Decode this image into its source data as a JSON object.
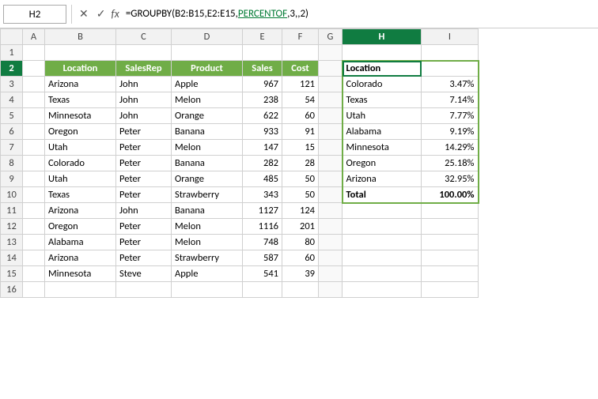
{
  "topbar": {
    "cell_ref": "H2",
    "fx_symbol": "fx",
    "formula": "=GROUPBY(B2:B15,E2:E15,PERCENTOF,3,,2)",
    "formula_parts": {
      "before": "=GROUPBY(B2:B15,E2:E15,",
      "highlighted": "PERCENTOF",
      "after": ",3,,2)"
    }
  },
  "col_headers": [
    "",
    "A",
    "B",
    "C",
    "D",
    "E",
    "F",
    "G",
    "H",
    "I"
  ],
  "rows": [
    {
      "row": "1",
      "cells": [
        "",
        "",
        "",
        "",
        "",
        "",
        "",
        "",
        "",
        ""
      ]
    },
    {
      "row": "2",
      "cells": [
        "",
        "",
        "Location",
        "SalesRep",
        "Product",
        "Sales",
        "Cost",
        "",
        "Location",
        ""
      ]
    },
    {
      "row": "3",
      "cells": [
        "",
        "",
        "Arizona",
        "John",
        "Apple",
        "967",
        "121",
        "",
        "Colorado",
        "3.47%"
      ]
    },
    {
      "row": "4",
      "cells": [
        "",
        "",
        "Texas",
        "John",
        "Melon",
        "238",
        "54",
        "",
        "Texas",
        "7.14%"
      ]
    },
    {
      "row": "5",
      "cells": [
        "",
        "",
        "Minnesota",
        "John",
        "Orange",
        "622",
        "60",
        "",
        "Utah",
        "7.77%"
      ]
    },
    {
      "row": "6",
      "cells": [
        "",
        "",
        "Oregon",
        "Peter",
        "Banana",
        "933",
        "91",
        "",
        "Alabama",
        "9.19%"
      ]
    },
    {
      "row": "7",
      "cells": [
        "",
        "",
        "Utah",
        "Peter",
        "Melon",
        "147",
        "15",
        "",
        "Minnesota",
        "14.29%"
      ]
    },
    {
      "row": "8",
      "cells": [
        "",
        "",
        "Colorado",
        "Peter",
        "Banana",
        "282",
        "28",
        "",
        "Oregon",
        "25.18%"
      ]
    },
    {
      "row": "9",
      "cells": [
        "",
        "",
        "Utah",
        "Peter",
        "Orange",
        "485",
        "50",
        "",
        "Arizona",
        "32.95%"
      ]
    },
    {
      "row": "10",
      "cells": [
        "",
        "",
        "Texas",
        "Peter",
        "Strawberry",
        "343",
        "50",
        "",
        "Total",
        "100.00%"
      ]
    },
    {
      "row": "11",
      "cells": [
        "",
        "",
        "Arizona",
        "John",
        "Banana",
        "1127",
        "124",
        "",
        "",
        ""
      ]
    },
    {
      "row": "12",
      "cells": [
        "",
        "",
        "Oregon",
        "Peter",
        "Melon",
        "1116",
        "201",
        "",
        "",
        ""
      ]
    },
    {
      "row": "13",
      "cells": [
        "",
        "",
        "Alabama",
        "Peter",
        "Melon",
        "748",
        "80",
        "",
        "",
        ""
      ]
    },
    {
      "row": "14",
      "cells": [
        "",
        "",
        "Arizona",
        "Peter",
        "Strawberry",
        "587",
        "60",
        "",
        "",
        ""
      ]
    },
    {
      "row": "15",
      "cells": [
        "",
        "",
        "Minnesota",
        "Steve",
        "Apple",
        "541",
        "39",
        "",
        "",
        ""
      ]
    },
    {
      "row": "16",
      "cells": [
        "",
        "",
        "",
        "",
        "",
        "",
        "",
        "",
        "",
        ""
      ]
    }
  ],
  "colors": {
    "header_bg": "#70ad47",
    "header_text": "#ffffff",
    "active_col_bg": "#107c41",
    "grid_border": "#d0d0d0",
    "result_border": "#70ad47"
  }
}
